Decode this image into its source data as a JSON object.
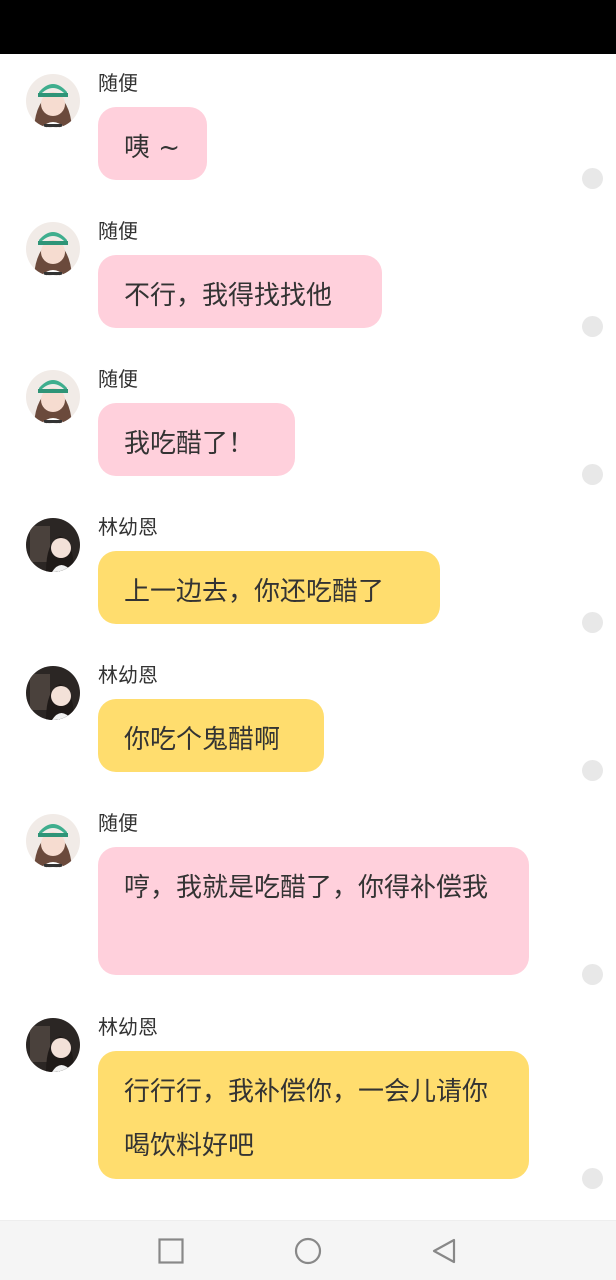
{
  "messages": [
    {
      "sender": "随便",
      "text": "咦 ~",
      "color": "#ffd0dc"
    },
    {
      "sender": "随便",
      "text": "不行，我得找找他",
      "color": "#ffd0dc"
    },
    {
      "sender": "随便",
      "text": "我吃醋了！",
      "color": "#ffd0dc"
    },
    {
      "sender": "林幼恩",
      "text": "上一边去，你还吃醋了",
      "color": "#ffdd6e"
    },
    {
      "sender": "林幼恩",
      "text": "你吃个鬼醋啊",
      "color": "#ffdd6e"
    },
    {
      "sender": "随便",
      "text": "哼，我就是吃醋了，你得补偿我",
      "color": "#ffd0dc"
    },
    {
      "sender": "林幼恩",
      "text": "行行行，我补偿你，一会儿请你喝饮料好吧",
      "color": "#ffdd6e"
    }
  ],
  "navigation": {
    "recents_icon": "square-icon",
    "home_icon": "circle-icon",
    "back_icon": "triangle-back-icon"
  }
}
